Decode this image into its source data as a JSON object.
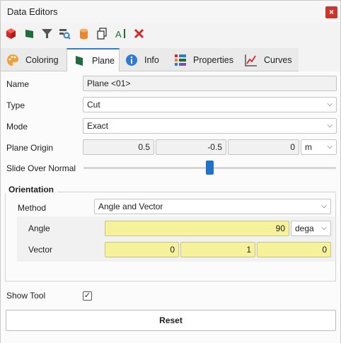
{
  "window": {
    "title": "Data Editors",
    "close_glyph": "×"
  },
  "toolbar": {
    "icons": [
      "cube-icon",
      "flag-icon",
      "filter-icon",
      "inspect-icon",
      "cylinder-icon",
      "copy-icon",
      "text-align-icon",
      "delete-icon"
    ]
  },
  "tabs": [
    {
      "label": "Coloring",
      "icon": "palette-icon"
    },
    {
      "label": "Plane",
      "icon": "flag-icon",
      "active": true
    },
    {
      "label": "Info",
      "icon": "info-icon"
    },
    {
      "label": "Properties",
      "icon": "grid-icon"
    },
    {
      "label": "Curves",
      "icon": "chart-icon"
    }
  ],
  "form": {
    "name_label": "Name",
    "name_value": "Plane <01>",
    "type_label": "Type",
    "type_value": "Cut",
    "mode_label": "Mode",
    "mode_value": "Exact",
    "origin_label": "Plane Origin",
    "origin_x": "0.5",
    "origin_y": "-0.5",
    "origin_z": "0",
    "origin_unit": "m",
    "slide_label": "Slide Over Normal",
    "slide_fraction": 0.5
  },
  "orientation": {
    "group_label": "Orientation",
    "method_label": "Method",
    "method_value": "Angle and Vector",
    "angle_label": "Angle",
    "angle_value": "90",
    "angle_unit": "dega",
    "vector_label": "Vector",
    "vector_x": "0",
    "vector_y": "1",
    "vector_z": "0"
  },
  "show_tool": {
    "label": "Show Tool",
    "checked": true,
    "check_glyph": "✓"
  },
  "reset_label": "Reset",
  "colors": {
    "accent": "#3b7dc4",
    "highlight_field": "#f6f29c",
    "close_button": "#c8372d"
  }
}
